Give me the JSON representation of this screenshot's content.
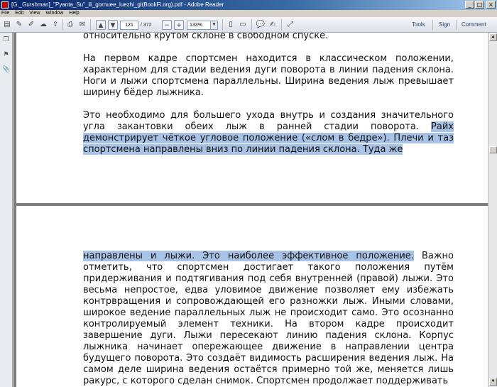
{
  "window": {
    "title": "[G._Gurshman]_\"Pyanta_Su\"_ili_gornuee_luezhi_gl(BookFi.org).pdf - Adobe Reader",
    "controls": {
      "minimize": "_",
      "maximize": "□",
      "close": "×"
    }
  },
  "menu": [
    "File",
    "Edit",
    "View",
    "Window",
    "Help"
  ],
  "toolbar": {
    "current_page": "121",
    "page_total": "/ 372",
    "zoom": "133%",
    "tools_label": "Tools",
    "sign_label": "Sign",
    "comment_label": "Comment"
  },
  "document": {
    "page1": {
      "line_top": "относительно крутом склоне в свободном спуске.",
      "para1": "На первом кадре спортсмен находится в классическом положении, характерном для стадии ведения дуги поворота в линии падения склона. Ноги и лыжи спортсмена параллельны. Ширина ведения лыж превышает ширину бёдер лыжника.",
      "para2_plain": "Это необходимо для большего ухода внутрь и создания значительного угла закантовки обеих лыж в ранней стадии поворота. ",
      "para2_highlighted": "Райх демонстрирует чёткое угловое положение («слом в бедре»). Плечи и таз спортсмена направлены вниз по линии падения склона. Туда же"
    },
    "page2": {
      "highlighted": "направлены и лыжи. Это наиболее эффективное положение.",
      "plain": " Важно отметить, что спортсмен достигает такого положения путём придерживания и подтягивания под себя внутренней (правой) лыжи. Это весьма непростое, едва уловимое движение позволяет ему избежать контрвращения и сопровождающей его разножки лыж. Иными словами, широкое ведение параллельных лыж не происходит само. Это осознанно контролируемый элемент техники. На втором кадре происходит завершение дуги. Лыжи пересекают линию падения склона. Корпус лыжника начинает опережающее движение в направлении центра будущего поворота. Это создаёт видимость расширения ведения лыж. На самом деле ширина ведения остаётся примерно той же, меняется лишь ракурс, с которого сделан снимок. Спортсмен продолжает поддерживать"
    }
  },
  "colors": {
    "highlight": "#a9c3e6",
    "title_bar": "#0a246a",
    "doc_background": "#7d7d7d"
  }
}
